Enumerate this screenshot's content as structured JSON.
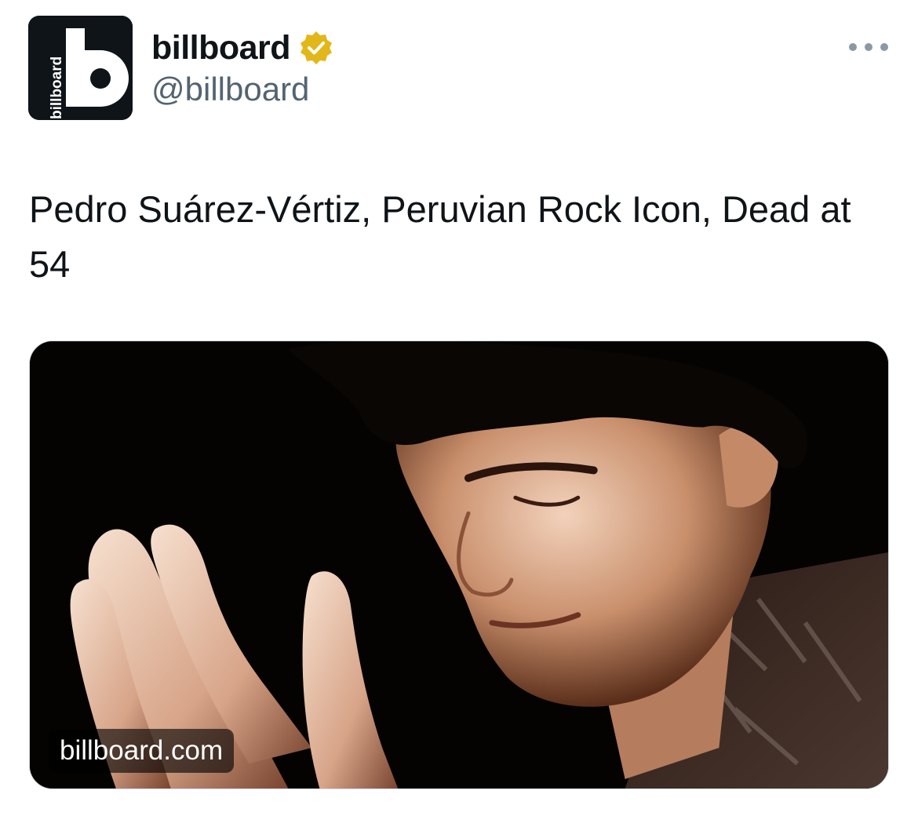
{
  "author": {
    "display_name": "billboard",
    "handle": "@billboard",
    "avatar_text": "billboard",
    "avatar_letter": "b",
    "verified": true,
    "badge_color": "#e2b719"
  },
  "tweet": {
    "text": "Pedro Suárez-Vértiz, Peruvian Rock Icon, Dead at 54"
  },
  "media": {
    "domain": "billboard.com",
    "image": "portrait-photo"
  },
  "icons": {
    "more": "more-options-icon",
    "verified": "verified-badge-icon"
  }
}
